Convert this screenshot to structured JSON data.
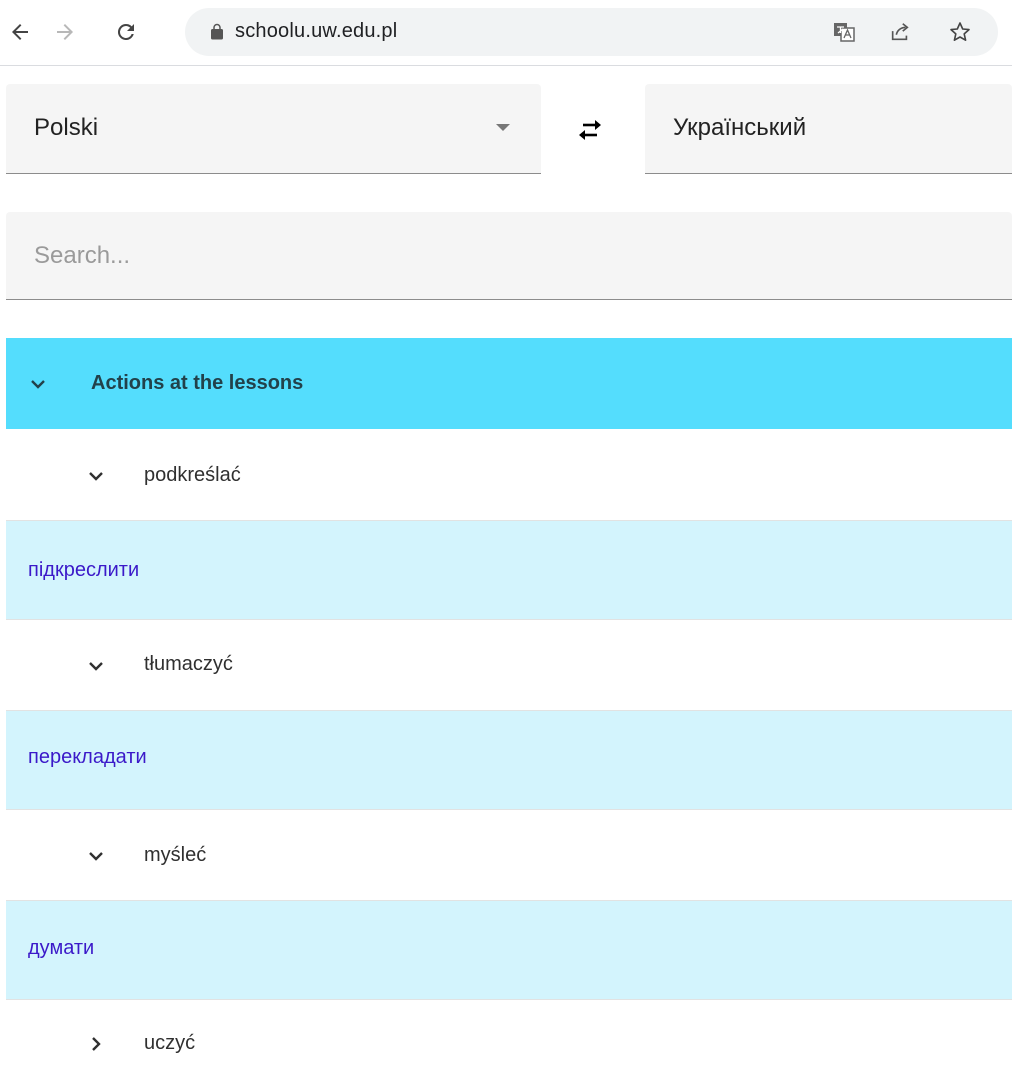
{
  "browser": {
    "url": "schoolu.uw.edu.pl",
    "icons": [
      "back-icon",
      "forward-icon",
      "reload-icon",
      "lock-icon",
      "translate-icon",
      "share-icon",
      "star-icon"
    ]
  },
  "languages": {
    "source": "Polski",
    "target": "Український",
    "swap_icon": "swap-arrows-icon"
  },
  "search": {
    "placeholder": "Search..."
  },
  "tree": {
    "category": {
      "label": "Actions at the lessons",
      "expanded": true,
      "color": "#54ddfd"
    },
    "entries": [
      {
        "word": "podkreślać",
        "expanded": true,
        "translation": "підкреслити"
      },
      {
        "word": "tłumaczyć",
        "expanded": true,
        "translation": "перекладати"
      },
      {
        "word": "myśleć",
        "expanded": true,
        "translation": "думати"
      },
      {
        "word": "uczyć",
        "expanded": false
      }
    ],
    "translation_bg": "#d3f4fd",
    "translation_color": "#3b19c9"
  }
}
